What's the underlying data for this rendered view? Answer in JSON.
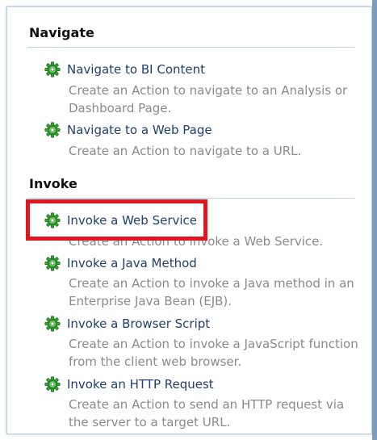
{
  "sections": [
    {
      "title": "Navigate",
      "items": [
        {
          "label": "Navigate to BI Content",
          "description": "Create an Action to navigate to an Analysis or Dashboard Page."
        },
        {
          "label": "Navigate to a Web Page",
          "description": "Create an Action to navigate to a URL."
        }
      ]
    },
    {
      "title": "Invoke",
      "items": [
        {
          "label": "Invoke a Web Service",
          "description": "Create an Action to invoke a Web Service."
        },
        {
          "label": "Invoke a Java Method",
          "description": "Create an Action to invoke a Java method in an Enterprise Java Bean (EJB)."
        },
        {
          "label": "Invoke a Browser Script",
          "description": "Create an Action to invoke a JavaScript function from the client web browser."
        },
        {
          "label": "Invoke an HTTP Request",
          "description": "Create an Action to send an HTTP request via the server to a target URL."
        }
      ]
    }
  ],
  "icon": "gear-icon",
  "colors": {
    "link": "#1f3f70",
    "description": "#8a8a8a",
    "icon": "#3aa83a",
    "highlight": "#e0151d"
  }
}
